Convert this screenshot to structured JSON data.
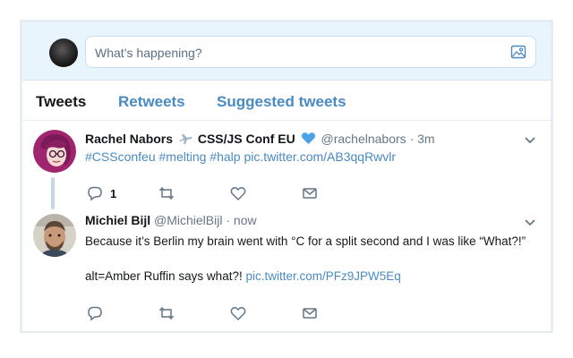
{
  "compose": {
    "placeholder": "What’s happening?"
  },
  "tabs": [
    {
      "label": "Tweets",
      "active": true
    },
    {
      "label": "Retweets",
      "active": false
    },
    {
      "label": "Suggested tweets",
      "active": false
    }
  ],
  "tweets": [
    {
      "name": "Rachel Nabors",
      "name_suffix": "CSS/JS Conf EU",
      "handle": "@rachelnabors",
      "time": "3m",
      "hashtags": "#CSSconfeu #melting #halp",
      "link": "pic.twitter.com/AB3qqRwvlr",
      "reply_count": "1"
    },
    {
      "name": "Michiel Bijl",
      "handle": "@MichielBijl",
      "time": "now",
      "text": "Because it’s Berlin my brain went with °C for a split second and I was like “What?!”",
      "alt_text": "alt=Amber Ruffin says what?!",
      "link": "pic.twitter.com/PFz9JPW5Eq"
    }
  ],
  "colors": {
    "link": "#4a8ac2",
    "compose_bg": "#e8f5fd",
    "heart_badge": "#4aa3e8"
  }
}
